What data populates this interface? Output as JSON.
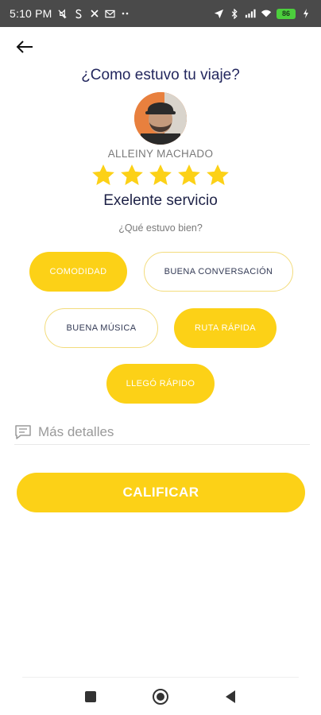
{
  "status_bar": {
    "time": "5:10 PM",
    "battery": "86",
    "left_icons": [
      "mute-icon",
      "s-icon",
      "cross-icon",
      "mail-icon",
      "more-dots-icon"
    ],
    "right_icons": [
      "location-icon",
      "bluetooth-icon",
      "signal-icon",
      "wifi-icon",
      "battery-icon",
      "charging-icon"
    ]
  },
  "header": {
    "title": "¿Como estuvo tu viaje?"
  },
  "driver": {
    "name": "ALLEINY MACHADO"
  },
  "rating": {
    "stars": 5,
    "max_stars": 5,
    "label": "Exelente servicio"
  },
  "feedback": {
    "question": "¿Qué estuvo bien?",
    "chips": [
      {
        "label": "COMODIDAD",
        "selected": true
      },
      {
        "label": "BUENA CONVERSACIÓN",
        "selected": false
      },
      {
        "label": "BUENA MÚSICA",
        "selected": false
      },
      {
        "label": "RUTA RÁPIDA",
        "selected": true
      },
      {
        "label": "LLEGÓ RÁPIDO",
        "selected": true
      }
    ]
  },
  "details": {
    "placeholder": "Más detalles"
  },
  "submit": {
    "label": "CALIFICAR"
  },
  "colors": {
    "accent": "#fcd117",
    "title": "#23275e",
    "status_bar": "#4a4a4a"
  }
}
